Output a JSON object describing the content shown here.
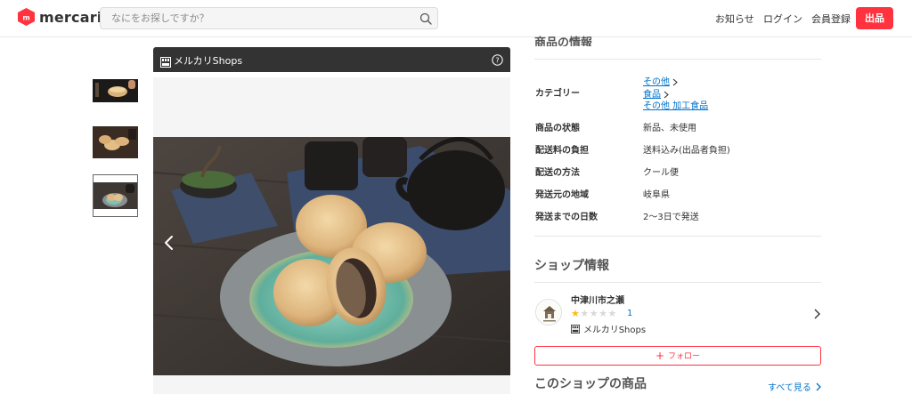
{
  "header": {
    "logo_text": "mercari",
    "search_placeholder": "なにをお探しですか？",
    "nav": {
      "notifications": "お知らせ",
      "login": "ログイン",
      "signup": "会員登録",
      "sell": "出品"
    }
  },
  "gallery": {
    "shops_label": "メルカリShops",
    "thumbnail_count": 3,
    "selected_thumbnail": 3
  },
  "details": {
    "section_title": "商品の情報",
    "category_label": "カテゴリー",
    "category_links": [
      "その他",
      "食品",
      "その他 加工食品"
    ],
    "rows": [
      {
        "label": "商品の状態",
        "value": "新品、未使用"
      },
      {
        "label": "配送料の負担",
        "value": "送料込み(出品者負担)"
      },
      {
        "label": "配送の方法",
        "value": "クール便"
      },
      {
        "label": "発送元の地域",
        "value": "岐阜県"
      },
      {
        "label": "発送までの日数",
        "value": "2〜3日で発送"
      }
    ]
  },
  "shop": {
    "section_title": "ショップ情報",
    "name": "中津川市之瀬",
    "rating_stars": 1,
    "rating_max": 5,
    "rating_count": "1",
    "badge_label": "メルカリShops",
    "follow_label": "フォロー",
    "more_title": "このショップの商品",
    "see_all": "すべて見る"
  },
  "colors": {
    "brand_red": "#ff333f",
    "link_blue": "#0073cc",
    "star_gold": "#ffb818",
    "shops_bar": "#333333"
  }
}
